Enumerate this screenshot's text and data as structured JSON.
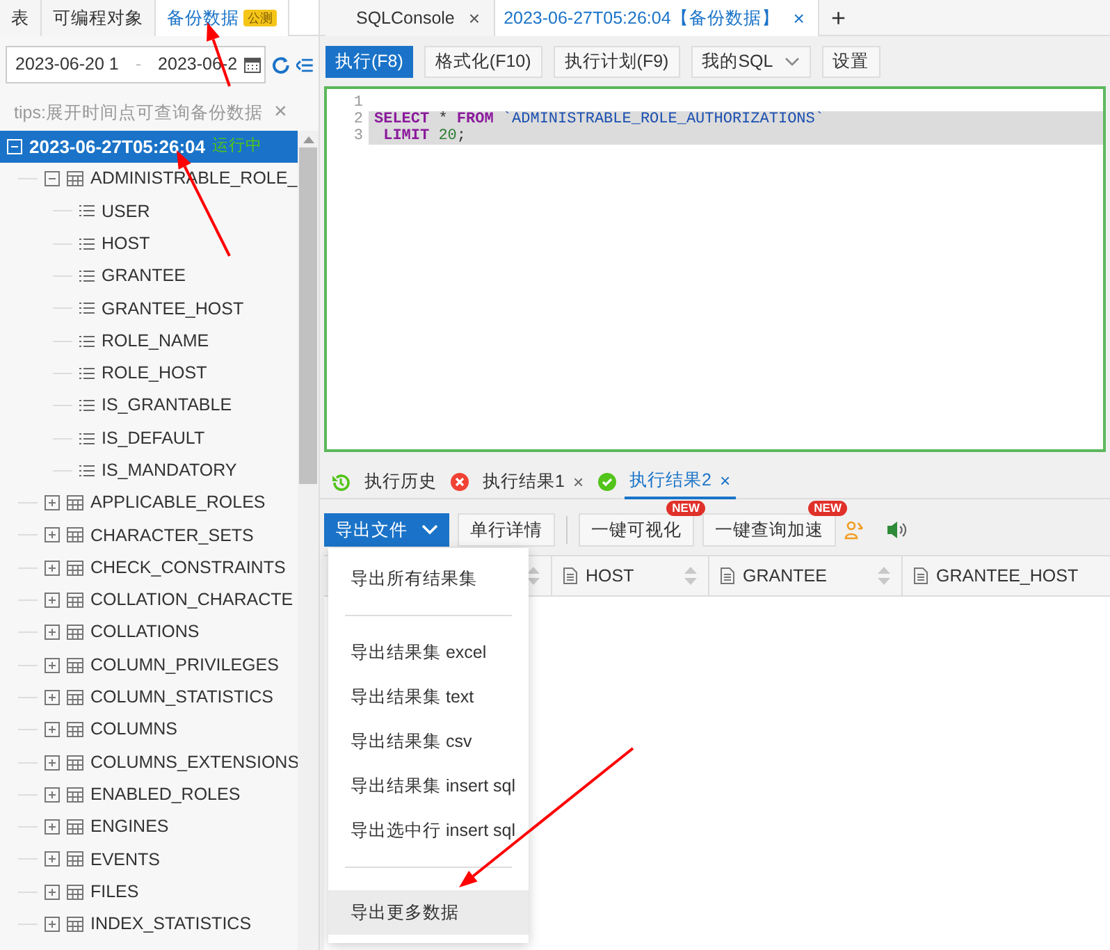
{
  "left_tabs": [
    {
      "label": "表",
      "selected": false
    },
    {
      "label": "可编程对象",
      "selected": false
    },
    {
      "label": "备份数据",
      "selected": true,
      "badge": "公测"
    }
  ],
  "date_range": {
    "start": "2023-06-20 1",
    "separator": "-",
    "end": "2023-06-2"
  },
  "tips": {
    "text": "tips:展开时间点可查询备份数据",
    "close": "×"
  },
  "tree": [
    {
      "kind": "backup",
      "label": "2023-06-27T05:26:04",
      "status": "运行中",
      "selected": true,
      "expanded": true,
      "children": [
        {
          "kind": "table",
          "label": "ADMINISTRABLE_ROLE_",
          "selected": false,
          "expanded": true,
          "children": [
            {
              "kind": "column",
              "label": "USER",
              "selected": false
            },
            {
              "kind": "column",
              "label": "HOST",
              "selected": false
            },
            {
              "kind": "column",
              "label": "GRANTEE",
              "selected": false
            },
            {
              "kind": "column",
              "label": "GRANTEE_HOST",
              "selected": false
            },
            {
              "kind": "column",
              "label": "ROLE_NAME",
              "selected": false
            },
            {
              "kind": "column",
              "label": "ROLE_HOST",
              "selected": false
            },
            {
              "kind": "column",
              "label": "IS_GRANTABLE",
              "selected": false
            },
            {
              "kind": "column",
              "label": "IS_DEFAULT",
              "selected": false
            },
            {
              "kind": "column",
              "label": "IS_MANDATORY",
              "selected": false
            }
          ]
        },
        {
          "kind": "table",
          "label": "APPLICABLE_ROLES",
          "selected": false,
          "expanded": false
        },
        {
          "kind": "table",
          "label": "CHARACTER_SETS",
          "selected": false,
          "expanded": false
        },
        {
          "kind": "table",
          "label": "CHECK_CONSTRAINTS",
          "selected": false,
          "expanded": false
        },
        {
          "kind": "table",
          "label": "COLLATION_CHARACTE",
          "selected": false,
          "expanded": false
        },
        {
          "kind": "table",
          "label": "COLLATIONS",
          "selected": false,
          "expanded": false
        },
        {
          "kind": "table",
          "label": "COLUMN_PRIVILEGES",
          "selected": false,
          "expanded": false
        },
        {
          "kind": "table",
          "label": "COLUMN_STATISTICS",
          "selected": false,
          "expanded": false
        },
        {
          "kind": "table",
          "label": "COLUMNS",
          "selected": false,
          "expanded": false
        },
        {
          "kind": "table",
          "label": "COLUMNS_EXTENSIONS",
          "selected": false,
          "expanded": false
        },
        {
          "kind": "table",
          "label": "ENABLED_ROLES",
          "selected": false,
          "expanded": false
        },
        {
          "kind": "table",
          "label": "ENGINES",
          "selected": false,
          "expanded": false
        },
        {
          "kind": "table",
          "label": "EVENTS",
          "selected": false,
          "expanded": false
        },
        {
          "kind": "table",
          "label": "FILES",
          "selected": false,
          "expanded": false
        },
        {
          "kind": "table",
          "label": "INDEX_STATISTICS",
          "selected": false,
          "expanded": false
        }
      ]
    }
  ],
  "editor_tabs": [
    {
      "label": "SQLConsole",
      "close": "×",
      "selected": false
    },
    {
      "label": "2023-06-27T05:26:04【备份数据】",
      "close": "×",
      "selected": true
    }
  ],
  "new_tab": "+",
  "toolbar": [
    {
      "label": "执行(F8)",
      "kind": "primary"
    },
    {
      "label": "格式化(F10)",
      "kind": "plain"
    },
    {
      "label": "执行计划(F9)",
      "kind": "plain"
    },
    {
      "label": "我的SQL",
      "kind": "dropdown"
    },
    {
      "label": "设置",
      "kind": "plain"
    }
  ],
  "editor": {
    "lines": [
      {
        "number": "1",
        "highlighted": false
      },
      {
        "number": "2",
        "highlighted": true,
        "tokens": [
          {
            "kind": "keyword",
            "text": "SELECT"
          },
          {
            "kind": "plain",
            "text": " * "
          },
          {
            "kind": "keyword",
            "text": "FROM"
          },
          {
            "kind": "identifier",
            "text": " `ADMINISTRABLE_ROLE_AUTHORIZATIONS`"
          }
        ]
      },
      {
        "number": "3",
        "highlighted": true,
        "tokens": [
          {
            "kind": "keyword",
            "text": " LIMIT"
          },
          {
            "kind": "number",
            "text": " 20"
          },
          {
            "kind": "plain",
            "text": ";"
          }
        ]
      }
    ]
  },
  "result_tabs": [
    {
      "label": "执行历史",
      "kind": "history",
      "selected": false
    },
    {
      "label": "执行结果1",
      "kind": "error",
      "close": "×",
      "selected": false
    },
    {
      "label": "执行结果2",
      "kind": "success",
      "close": "×",
      "selected": true
    }
  ],
  "result_toolbar": [
    {
      "label": "导出文件",
      "kind": "primary-dropdown"
    },
    {
      "label": "单行详情",
      "kind": "plain"
    },
    {
      "kind": "separator"
    },
    {
      "label": "一键可视化",
      "kind": "plain",
      "badge": "NEW"
    },
    {
      "label": "一键查询加速",
      "kind": "plain",
      "badge": "NEW"
    },
    {
      "kind": "icon-people"
    },
    {
      "kind": "icon-speaker"
    }
  ],
  "grid": {
    "columns": [
      {
        "kind": "covered"
      },
      {
        "kind": "named",
        "label": "HOST"
      },
      {
        "kind": "named",
        "label": "GRANTEE"
      },
      {
        "kind": "named",
        "label": "GRANTEE_HOST"
      }
    ]
  },
  "export_menu": [
    {
      "kind": "item",
      "label": "导出所有结果集",
      "highlighted": false
    },
    {
      "kind": "divider"
    },
    {
      "kind": "item",
      "label": "导出结果集 excel",
      "highlighted": false
    },
    {
      "kind": "item",
      "label": "导出结果集 text",
      "highlighted": false
    },
    {
      "kind": "item",
      "label": "导出结果集 csv",
      "highlighted": false
    },
    {
      "kind": "item",
      "label": "导出结果集 insert sql",
      "highlighted": false
    },
    {
      "kind": "item",
      "label": "导出选中行 insert sql",
      "highlighted": false
    },
    {
      "kind": "divider"
    },
    {
      "kind": "item",
      "label": "导出更多数据",
      "highlighted": true
    }
  ],
  "annotations": [
    {
      "kind": "arrow"
    },
    {
      "kind": "arrow"
    },
    {
      "kind": "arrow"
    }
  ]
}
